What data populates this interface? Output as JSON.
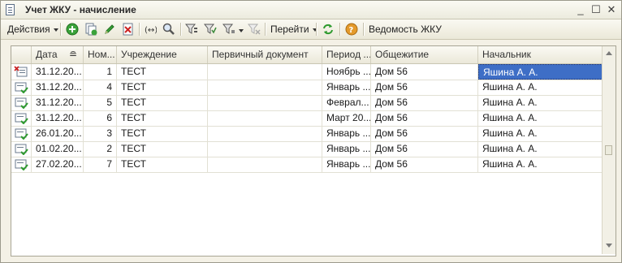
{
  "window": {
    "title": "Учет ЖКУ - начисление"
  },
  "toolbar": {
    "actions_label": "Действия",
    "goto_label": "Перейти",
    "report_label": "Ведомость ЖКУ"
  },
  "grid": {
    "columns": [
      "Дата",
      "Ном...",
      "Учреждение",
      "Первичный документ",
      "Период ...",
      "Общежитие",
      "Начальник"
    ],
    "rows": [
      {
        "status": "deleted",
        "date": "31.12.20...",
        "num": "1",
        "org": "ТЕСТ",
        "doc": "",
        "period": "Ноябрь ...",
        "dorm": "Дом 56",
        "head": "Яшина А. А."
      },
      {
        "status": "posted",
        "date": "31.12.20...",
        "num": "4",
        "org": "ТЕСТ",
        "doc": "",
        "period": "Январь ...",
        "dorm": "Дом 56",
        "head": "Яшина А. А."
      },
      {
        "status": "posted",
        "date": "31.12.20...",
        "num": "5",
        "org": "ТЕСТ",
        "doc": "",
        "period": "Феврал...",
        "dorm": "Дом 56",
        "head": "Яшина А. А."
      },
      {
        "status": "posted",
        "date": "31.12.20...",
        "num": "6",
        "org": "ТЕСТ",
        "doc": "",
        "period": "Март 20...",
        "dorm": "Дом 56",
        "head": "Яшина А. А."
      },
      {
        "status": "posted",
        "date": "26.01.20...",
        "num": "3",
        "org": "ТЕСТ",
        "doc": "",
        "period": "Январь ...",
        "dorm": "Дом 56",
        "head": "Яшина А. А."
      },
      {
        "status": "posted",
        "date": "01.02.20...",
        "num": "2",
        "org": "ТЕСТ",
        "doc": "",
        "period": "Январь ...",
        "dorm": "Дом 56",
        "head": "Яшина А. А."
      },
      {
        "status": "posted",
        "date": "27.02.20...",
        "num": "7",
        "org": "ТЕСТ",
        "doc": "",
        "period": "Январь ...",
        "dorm": "Дом 56",
        "head": "Яшина А. А."
      }
    ],
    "selected_row": 0,
    "selected_col": "head"
  },
  "colors": {
    "selection": "#3e6ec6",
    "add_green": "#3aa23a",
    "refresh_green": "#2e9a2e",
    "help_orange": "#e49a2b",
    "delete_red": "#cc2222"
  }
}
